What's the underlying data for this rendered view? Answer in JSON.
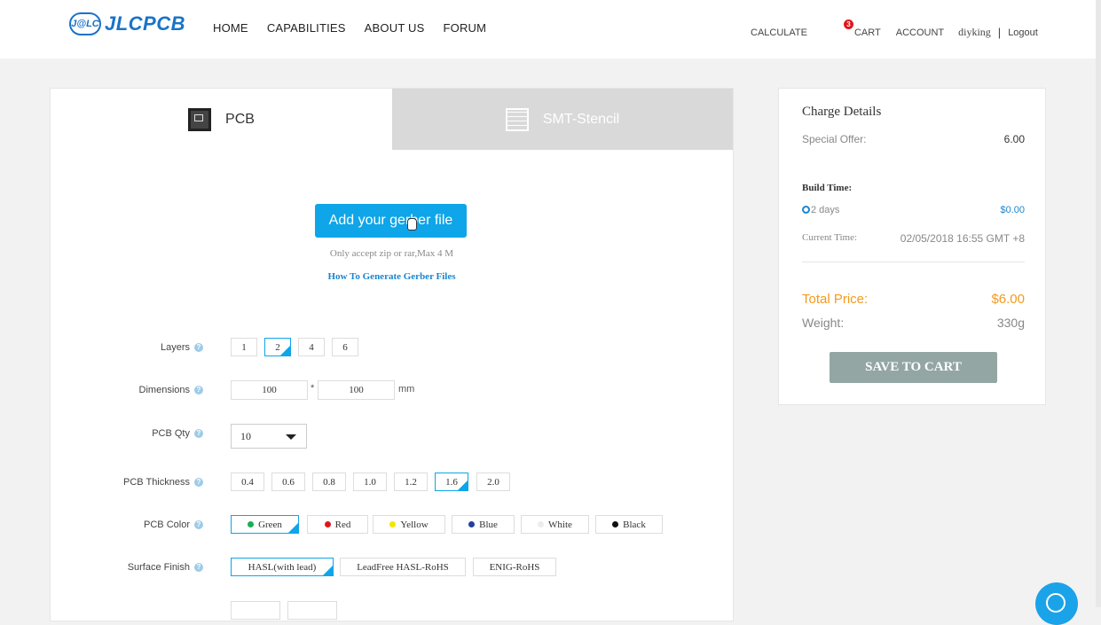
{
  "header": {
    "logo_badge": "J@LC",
    "logo_text": "JLCPCB",
    "nav": [
      "HOME",
      "CAPABILITIES",
      "ABOUT US",
      "FORUM"
    ],
    "calculate": "CALCULATE",
    "cart_count": "3",
    "cart": "CART",
    "account": "ACCOUNT",
    "username": "diyking",
    "separator": "|",
    "logout": "Logout"
  },
  "tabs": {
    "pcb": "PCB",
    "smt": "SMT-Stencil"
  },
  "upload": {
    "button": "Add your gerber file",
    "note": "Only accept zip or rar,Max 4 M",
    "link": "How To Generate Gerber Files"
  },
  "form": {
    "layers": {
      "label": "Layers",
      "options": [
        "1",
        "2",
        "4",
        "6"
      ],
      "selected": "2"
    },
    "dimensions": {
      "label": "Dimensions",
      "width": "100",
      "times": "*",
      "height": "100",
      "unit": "mm"
    },
    "qty": {
      "label": "PCB Qty",
      "value": "10"
    },
    "thickness": {
      "label": "PCB Thickness",
      "options": [
        "0.4",
        "0.6",
        "0.8",
        "1.0",
        "1.2",
        "1.6",
        "2.0"
      ],
      "selected": "1.6"
    },
    "color": {
      "label": "PCB Color",
      "options": [
        "Green",
        "Red",
        "Yellow",
        "Blue",
        "White",
        "Black"
      ],
      "swatches": [
        "#1aae55",
        "#e0161b",
        "#f2e600",
        "#23409c",
        "#ececec",
        "#111111"
      ],
      "selected": "Green"
    },
    "finish": {
      "label": "Surface Finish",
      "options": [
        "HASL(with lead)",
        "LeadFree HASL-RoHS",
        "ENIG-RoHS"
      ],
      "selected": "HASL(with lead)"
    },
    "help_glyph": "?"
  },
  "charge": {
    "title": "Charge Details",
    "offer_label": "Special Offer:",
    "offer_value": "6.00",
    "build_label": "Build Time:",
    "build_option": "2 days",
    "build_price": "$0.00",
    "current_label": "Current Time:",
    "current_value": "02/05/2018 16:55 GMT +8",
    "total_label": "Total Price:",
    "total_value": "$6.00",
    "weight_label": "Weight:",
    "weight_value": "330g",
    "save": "SAVE TO CART"
  },
  "colors": {
    "accent": "#0ea5e9",
    "total": "#f39a1e",
    "save_button": "#93a6a4",
    "cart_badge": "#e0161b"
  }
}
